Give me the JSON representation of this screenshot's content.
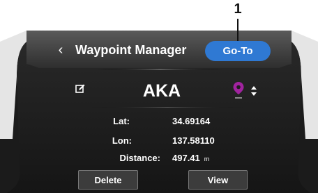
{
  "callout": {
    "number": "1"
  },
  "header": {
    "back_icon": "chevron-left-icon",
    "back_glyph": "‹",
    "title": "Waypoint Manager",
    "goto_label": "Go-To"
  },
  "waypoint": {
    "edit_icon": "edit-icon",
    "name": "AKA",
    "pin_icon": "map-pin-icon",
    "pin_color": "#a1239f",
    "sort_icon": "sort-updown-icon",
    "fields": [
      {
        "label": "Lat:",
        "value": "34.69164",
        "unit": ""
      },
      {
        "label": "Lon:",
        "value": "137.58110",
        "unit": ""
      },
      {
        "label": "Distance:",
        "value": "497.41",
        "unit": "m"
      }
    ]
  },
  "actions": {
    "delete_label": "Delete",
    "view_label": "View"
  },
  "colors": {
    "accent": "#2f79d3",
    "panel": "#232323",
    "header": "#404040"
  }
}
